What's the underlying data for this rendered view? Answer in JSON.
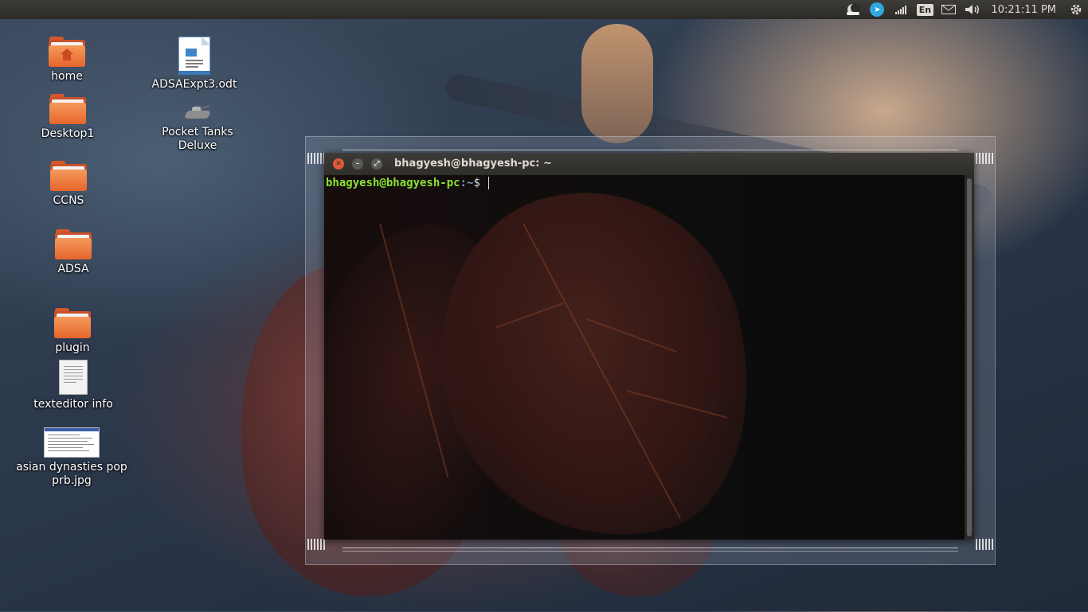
{
  "panel": {
    "clock": "10:21:11 PM",
    "keyboard_layout": "En",
    "indicators": [
      "moon-indicator-icon",
      "telegram-icon",
      "network-signal-icon",
      "keyboard-layout-icon",
      "mail-icon",
      "volume-icon",
      "power-gear-icon"
    ]
  },
  "desktop": {
    "icons": [
      {
        "label": "home",
        "icon": "home-folder-icon"
      },
      {
        "label": "Desktop1",
        "icon": "folder-icon"
      },
      {
        "label": "CCNS",
        "icon": "folder-icon"
      },
      {
        "label": "ADSA",
        "icon": "folder-icon"
      },
      {
        "label": "plugin",
        "icon": "folder-icon"
      },
      {
        "label": "texteditor info",
        "icon": "text-file-icon"
      },
      {
        "label": "asian dynasties pop prb.jpg",
        "icon": "image-thumbnail-icon"
      },
      {
        "label": "ADSAExpt3.odt",
        "icon": "odt-document-icon"
      },
      {
        "label": "Pocket Tanks Deluxe",
        "icon": "tank-game-icon"
      }
    ]
  },
  "terminal": {
    "title": "bhagyesh@bhagyesh-pc: ~",
    "prompt_user": "bhagyesh@bhagyesh-pc",
    "prompt_path": ":~",
    "prompt_sign": "$",
    "colors": {
      "user": "#8ae234",
      "path": "#729fcf"
    }
  },
  "colors": {
    "panel_bg": "#2b2a27",
    "folder_orange": "#e7652b",
    "close_button": "#e05a3a"
  }
}
